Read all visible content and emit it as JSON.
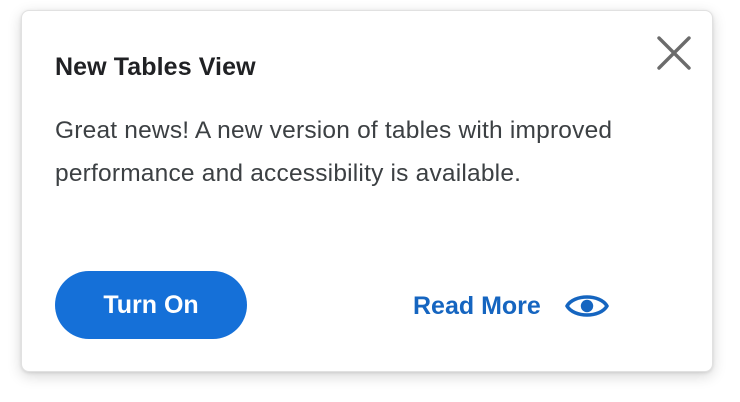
{
  "dialog": {
    "title": "New Tables View",
    "message": "Great news! A new version of tables with improved performance and accessibility is available.",
    "primary_button_label": "Turn On",
    "secondary_link_label": "Read More"
  },
  "icons": {
    "close": "close-icon",
    "read_more": "eye-icon"
  },
  "colors": {
    "primary": "#1570d8",
    "link": "#1565c0",
    "title": "#202124",
    "text": "#3c4043",
    "close_icon": "#6b6b6b"
  }
}
